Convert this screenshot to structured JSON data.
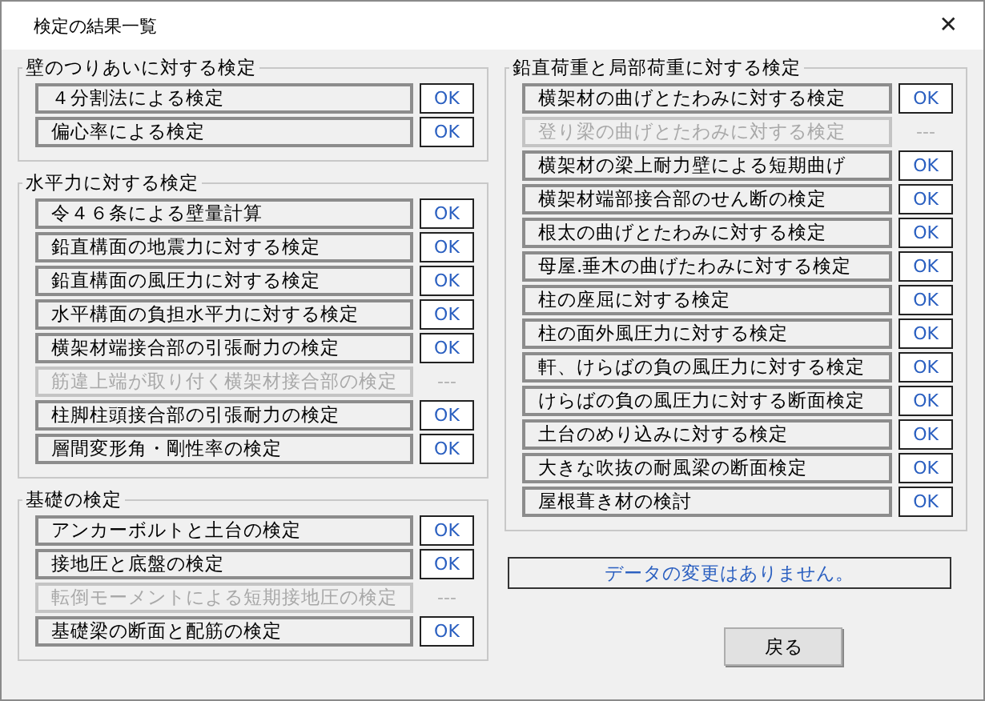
{
  "window": {
    "title": "検定の結果一覧",
    "close": "✕"
  },
  "left_groups": [
    {
      "title": "壁のつりあいに対する検定",
      "items": [
        {
          "label": "４分割法による検定",
          "result": "OK",
          "disabled": false
        },
        {
          "label": "偏心率による検定",
          "result": "OK",
          "disabled": false
        }
      ]
    },
    {
      "title": "水平力に対する検定",
      "items": [
        {
          "label": "令４６条による壁量計算",
          "result": "OK",
          "disabled": false
        },
        {
          "label": "鉛直構面の地震力に対する検定",
          "result": "OK",
          "disabled": false
        },
        {
          "label": "鉛直構面の風圧力に対する検定",
          "result": "OK",
          "disabled": false
        },
        {
          "label": "水平構面の負担水平力に対する検定",
          "result": "OK",
          "disabled": false
        },
        {
          "label": "横架材端接合部の引張耐力の検定",
          "result": "OK",
          "disabled": false
        },
        {
          "label": "筋違上端が取り付く横架材接合部の検定",
          "result": "---",
          "disabled": true
        },
        {
          "label": "柱脚柱頭接合部の引張耐力の検定",
          "result": "OK",
          "disabled": false
        },
        {
          "label": "層間変形角・剛性率の検定",
          "result": "OK",
          "disabled": false
        }
      ]
    },
    {
      "title": "基礎の検定",
      "items": [
        {
          "label": "アンカーボルトと土台の検定",
          "result": "OK",
          "disabled": false
        },
        {
          "label": "接地圧と底盤の検定",
          "result": "OK",
          "disabled": false
        },
        {
          "label": "転倒モーメントによる短期接地圧の検定",
          "result": "---",
          "disabled": true
        },
        {
          "label": "基礎梁の断面と配筋の検定",
          "result": "OK",
          "disabled": false
        }
      ]
    }
  ],
  "right_groups": [
    {
      "title": "鉛直荷重と局部荷重に対する検定",
      "items": [
        {
          "label": "横架材の曲げとたわみに対する検定",
          "result": "OK",
          "disabled": false
        },
        {
          "label": "登り梁の曲げとたわみに対する検定",
          "result": "---",
          "disabled": true
        },
        {
          "label": "横架材の梁上耐力壁による短期曲げ",
          "result": "OK",
          "disabled": false
        },
        {
          "label": "横架材端部接合部のせん断の検定",
          "result": "OK",
          "disabled": false
        },
        {
          "label": "根太の曲げとたわみに対する検定",
          "result": "OK",
          "disabled": false
        },
        {
          "label": "母屋.垂木の曲げたわみに対する検定",
          "result": "OK",
          "disabled": false
        },
        {
          "label": "柱の座屈に対する検定",
          "result": "OK",
          "disabled": false
        },
        {
          "label": "柱の面外風圧力に対する検定",
          "result": "OK",
          "disabled": false
        },
        {
          "label": "軒、けらばの負の風圧力に対する検定",
          "result": "OK",
          "disabled": false
        },
        {
          "label": "けらばの負の風圧力に対する断面検定",
          "result": "OK",
          "disabled": false
        },
        {
          "label": "土台のめり込みに対する検定",
          "result": "OK",
          "disabled": false
        },
        {
          "label": "大きな吹抜の耐風梁の断面検定",
          "result": "OK",
          "disabled": false
        },
        {
          "label": "屋根葺き材の検討",
          "result": "OK",
          "disabled": false
        }
      ]
    }
  ],
  "message": "データの変更はありません。",
  "back_button": "戻る"
}
